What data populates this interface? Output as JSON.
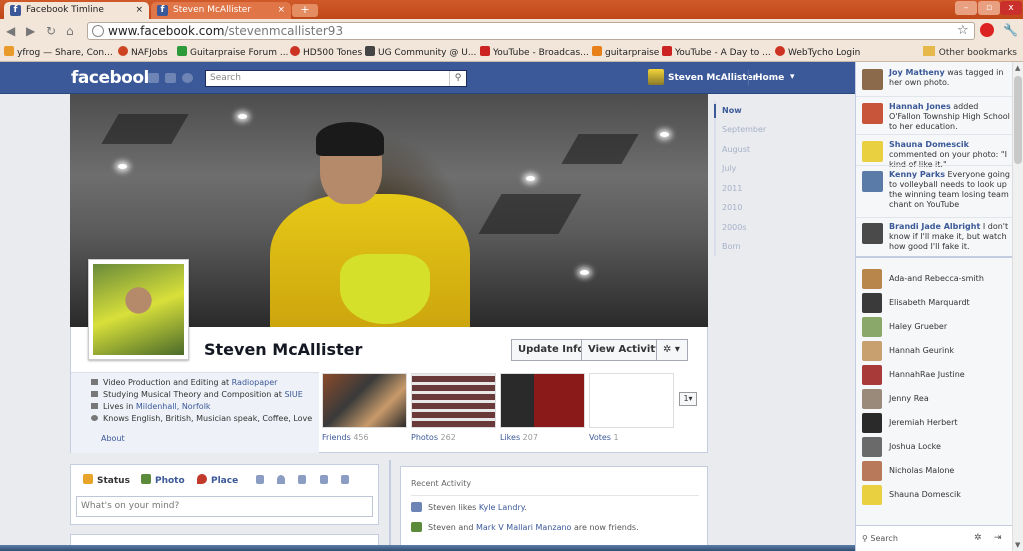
{
  "browser": {
    "tabs": [
      {
        "label": "Facebook Timline",
        "active": true
      },
      {
        "label": "Steven McAllister",
        "active": false
      }
    ],
    "new_tab_symbol": "+",
    "window_controls": {
      "minimize": "–",
      "maximize": "▫",
      "close": "x"
    },
    "url_host": "www.facebook.com",
    "url_path": "/stevenmcallister93",
    "bookmarks": [
      {
        "label": "yfrog — Share, Con...",
        "color": "#e89a2a"
      },
      {
        "label": "NAFJobs",
        "color": "#cc4422"
      },
      {
        "label": "Guitarpraise Forum ...",
        "color": "#2e9b3a"
      },
      {
        "label": "HD500 Tones",
        "color": "#cc3322"
      },
      {
        "label": "UG Community @ U...",
        "color": "#444444"
      },
      {
        "label": "YouTube - Broadcas...",
        "color": "#cc2222"
      },
      {
        "label": "guitarpraise",
        "color": "#e8801a"
      },
      {
        "label": "YouTube - A Day to ...",
        "color": "#cc2222"
      },
      {
        "label": "WebTycho Login",
        "color": "#cc3322"
      }
    ],
    "other_bookmarks": "Other bookmarks"
  },
  "fb": {
    "logo": "facebook",
    "search_placeholder": "Search",
    "nav_name": "Steven McAllister",
    "nav_home": "Home",
    "nav_arrow": "▾"
  },
  "profile": {
    "name": "Steven McAllister",
    "buttons": {
      "update_info": "Update Info",
      "view_activity": "View Activity",
      "settings": "✲ ▾"
    },
    "facts": [
      {
        "text": "Video Production and Editing at ",
        "link": "Radiopaper"
      },
      {
        "text": "Studying Musical Theory and Composition at ",
        "link": "SIUE"
      },
      {
        "text": "Lives in ",
        "link": "Mildenhall, Norfolk"
      },
      {
        "text": "Knows English, British, Musician speak, Coffee, Love",
        "link": ""
      }
    ],
    "about": "About",
    "thumbs": [
      {
        "label": "Friends",
        "count": "456"
      },
      {
        "label": "Photos",
        "count": "262"
      },
      {
        "label": "Likes",
        "count": "207"
      },
      {
        "label": "Votes",
        "count": "1"
      }
    ],
    "more": "1▾"
  },
  "timeline_years": [
    "Now",
    "September",
    "August",
    "July",
    "2011",
    "2010",
    "2000s",
    "Born"
  ],
  "composer": {
    "tabs": [
      {
        "label": "Status",
        "color": "#e8a52a"
      },
      {
        "label": "Photo",
        "color": "#5a8a3a"
      },
      {
        "label": "Place",
        "color": "#c0392b"
      }
    ],
    "placeholder": "What's on your mind?"
  },
  "activity": {
    "header": "Recent Activity",
    "rows": [
      {
        "pre": "Steven likes ",
        "link": "Kyle Landry",
        "post": "."
      },
      {
        "pre": "Steven and ",
        "link": "Mark V Mallari Manzano",
        "post": " are now friends."
      }
    ]
  },
  "ticker": [
    {
      "name": "Joy Matheny",
      "text": " was tagged in her own photo.",
      "color": "#8a6a4a"
    },
    {
      "name": "Hannah Jones",
      "text": " added O'Fallon Township High School to her education.",
      "color": "#c8553a"
    },
    {
      "name": "Shauna Domescik",
      "text": " commented on your photo: \"I kind of like it.\"",
      "color": "#e8d040"
    },
    {
      "name": "Kenny Parks",
      "text": " Everyone going to volleyball needs to look up the winning team losing team chant on YouTube",
      "color": "#5a7aa8"
    },
    {
      "name": "Brandi Jade Albright",
      "text": " I don't know if I'll make it, but watch how good I'll fake it.",
      "color": "#4a4a4a"
    }
  ],
  "chat_friends": [
    {
      "name": "Ada-and Rebecca-smith",
      "color": "#b8864a"
    },
    {
      "name": "Elisabeth Marquardt",
      "color": "#3a3a3a"
    },
    {
      "name": "Haley Grueber",
      "color": "#8aa86a"
    },
    {
      "name": "Hannah Geurink",
      "color": "#c8a070"
    },
    {
      "name": "HannahRae Justine",
      "color": "#a83a3a"
    },
    {
      "name": "Jenny Rea",
      "color": "#9a8a7a"
    },
    {
      "name": "Jeremiah Herbert",
      "color": "#2a2a2a"
    },
    {
      "name": "Joshua Locke",
      "color": "#6a6a6a"
    },
    {
      "name": "Nicholas Malone",
      "color": "#b8785a"
    },
    {
      "name": "Shauna Domescik",
      "color": "#e8d040"
    }
  ],
  "chat_search": "Search"
}
